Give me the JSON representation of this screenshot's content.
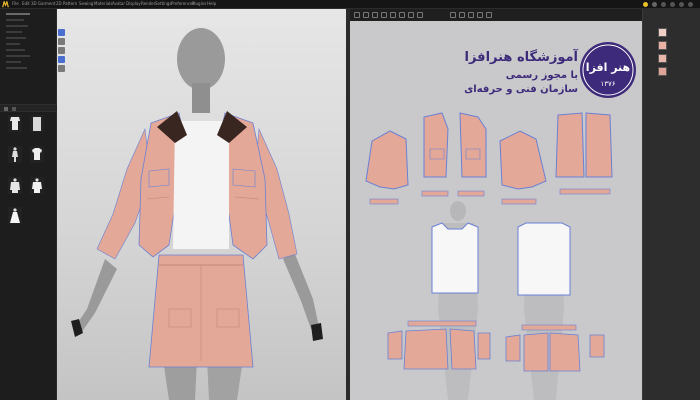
{
  "menubar": {
    "items": [
      "File",
      "Edit",
      "3D Garment",
      "2D Pattern",
      "Sewing",
      "Materials",
      "Avatar",
      "Display",
      "Render",
      "Settings",
      "Preferences",
      "Plugins",
      "Help"
    ]
  },
  "colors": {
    "fabric": "#e3a898",
    "fabric_dark": "#c98f80",
    "outline_blue": "#6a80d4",
    "collar": "#3a2620",
    "avatar": "#9a9a9a",
    "white_top": "#f4f4f4",
    "viewport_bg": "#c9c9cb",
    "watermark": "#3d2a7a"
  },
  "watermark": {
    "line1": "آموزشگاه هنرافزا",
    "line2": "با مجوز رسمی",
    "line3": "سازمان فنی و حرفه‌ای",
    "seal_text": "هنر افزا",
    "seal_year": "۱۳۷۶"
  },
  "library": {
    "items": [
      "shirt-thumb",
      "dress-thumb",
      "avatar-thumb",
      "tshirt-thumb",
      "jacket-thumb",
      "coat-thumb",
      "gown-thumb"
    ]
  },
  "icons": {
    "logo": "app-logo-icon",
    "tools": [
      "select-tool-icon",
      "move-tool-icon",
      "rotate-tool-icon",
      "fold-tool-icon",
      "pin-tool-icon"
    ]
  },
  "object_browser": {
    "swatch_colors": [
      "#f0d0c6",
      "#e9b0a3",
      "#e8b6aa",
      "#dfa497"
    ]
  }
}
